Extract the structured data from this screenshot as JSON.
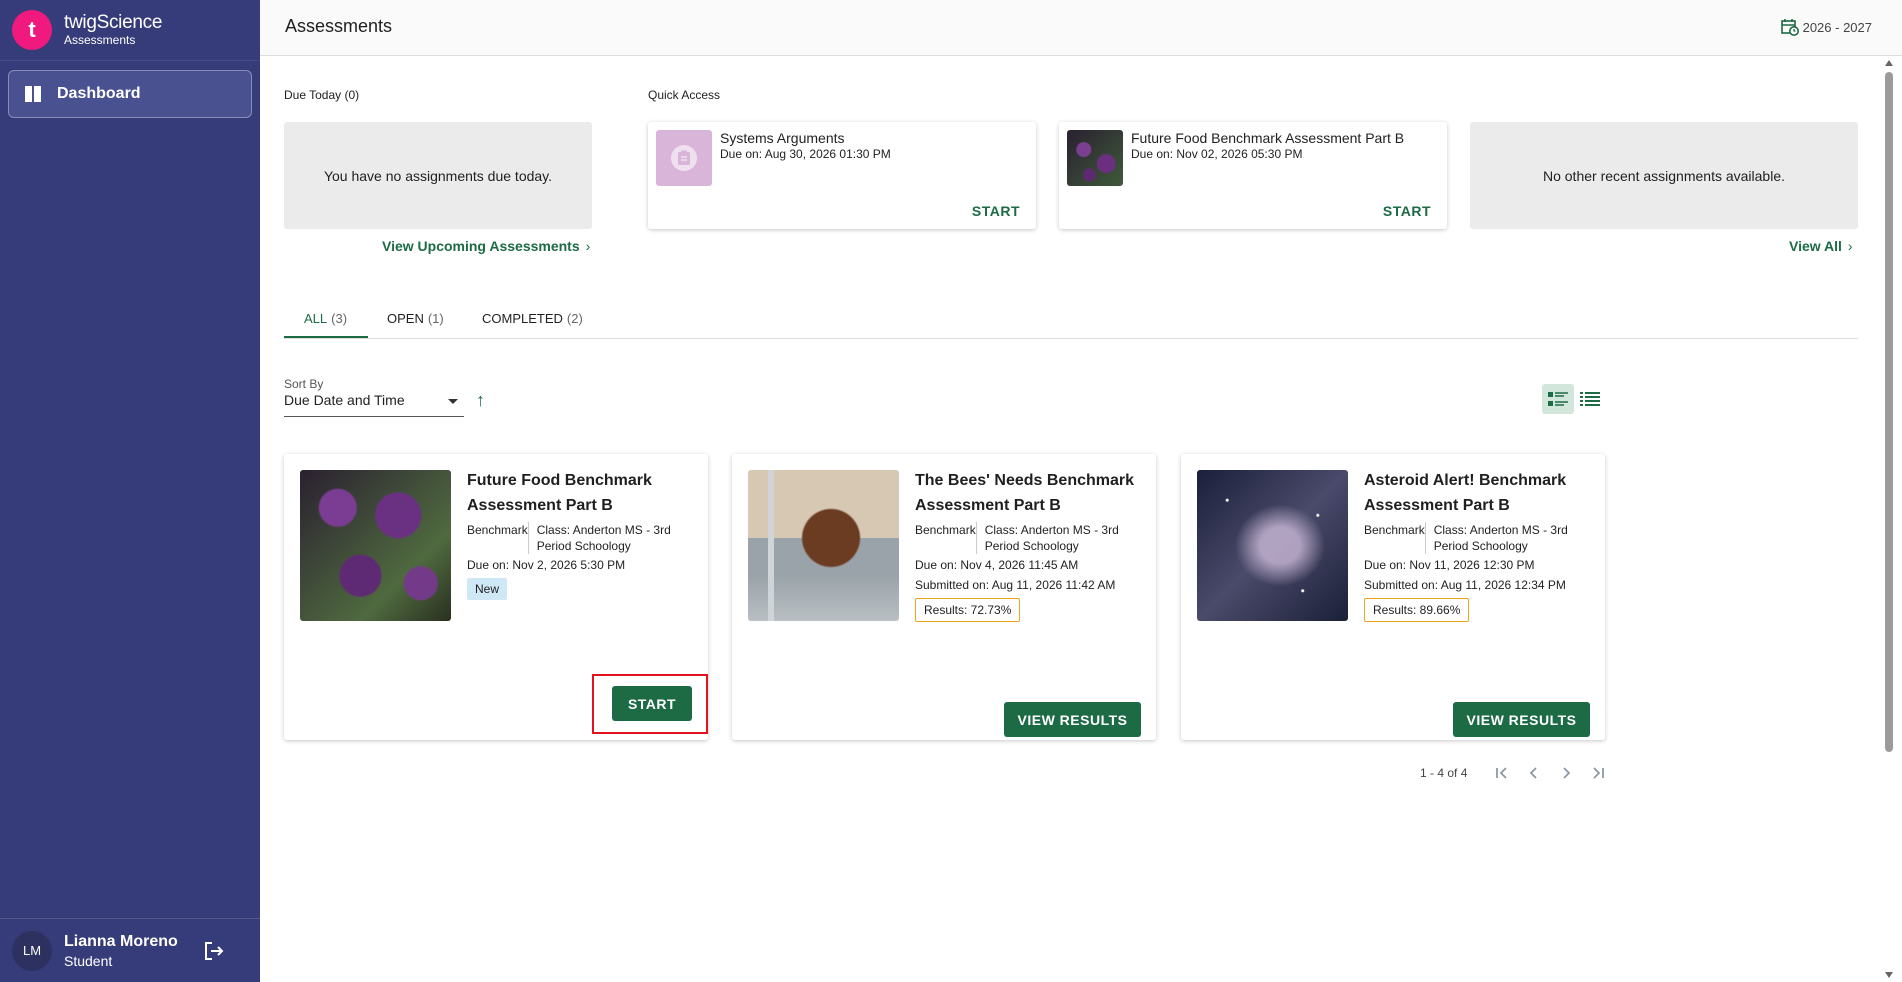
{
  "app": {
    "brand_name": "twigScience",
    "brand_sub": "Assessments",
    "logo_letter": "t",
    "logo_color": "#f0197d"
  },
  "sidebar": {
    "items": [
      {
        "label": "Dashboard",
        "icon": "dashboard-icon"
      }
    ]
  },
  "user": {
    "initials": "LM",
    "name": "Lianna Moreno",
    "role": "Student"
  },
  "header": {
    "title": "Assessments",
    "year": "2026 - 2027"
  },
  "due_today": {
    "label": "Due Today (0)",
    "empty": "You have no assignments due today.",
    "link": "View Upcoming Assessments"
  },
  "quick_access": {
    "label": "Quick Access",
    "cards": [
      {
        "title": "Systems Arguments",
        "due": "Due on: Aug 30, 2026 01:30 PM",
        "action": "START"
      },
      {
        "title": "Future Food Benchmark Assessment Part B",
        "due": "Due on: Nov 02, 2026 05:30 PM",
        "action": "START"
      }
    ],
    "empty": "No other recent assignments available.",
    "view_all": "View All"
  },
  "tabs": [
    {
      "label": "ALL",
      "count": "(3)"
    },
    {
      "label": "OPEN",
      "count": "(1)"
    },
    {
      "label": "COMPLETED",
      "count": "(2)"
    }
  ],
  "sort": {
    "label": "Sort By",
    "value": "Due Date and Time"
  },
  "cards": [
    {
      "title": "Future Food Benchmark Assessment Part B",
      "type": "Benchmark",
      "class": "Class: Anderton MS - 3rd Period Schoology",
      "due": "Due on: Nov 2, 2026 5:30 PM",
      "badge": "New",
      "action": "START"
    },
    {
      "title": "The Bees' Needs Benchmark Assessment Part B",
      "type": "Benchmark",
      "class": "Class: Anderton MS - 3rd Period Schoology",
      "due": "Due on: Nov 4, 2026 11:45 AM",
      "submitted": "Submitted on: Aug 11, 2026 11:42 AM",
      "result": "Results: 72.73%",
      "action": "VIEW RESULTS"
    },
    {
      "title": "Asteroid Alert! Benchmark Assessment Part B",
      "type": "Benchmark",
      "class": "Class: Anderton MS - 3rd Period Schoology",
      "due": "Due on: Nov 11, 2026 12:30 PM",
      "submitted": "Submitted on: Aug 11, 2026 12:34 PM",
      "result": "Results: 89.66%",
      "action": "VIEW RESULTS"
    }
  ],
  "pagination": {
    "range": "1 - 4 of 4"
  },
  "colors": {
    "sidebar": "#363c79",
    "accent": "#1c6b45",
    "highlight": "#e0141e",
    "results_border": "#f0a41c"
  }
}
